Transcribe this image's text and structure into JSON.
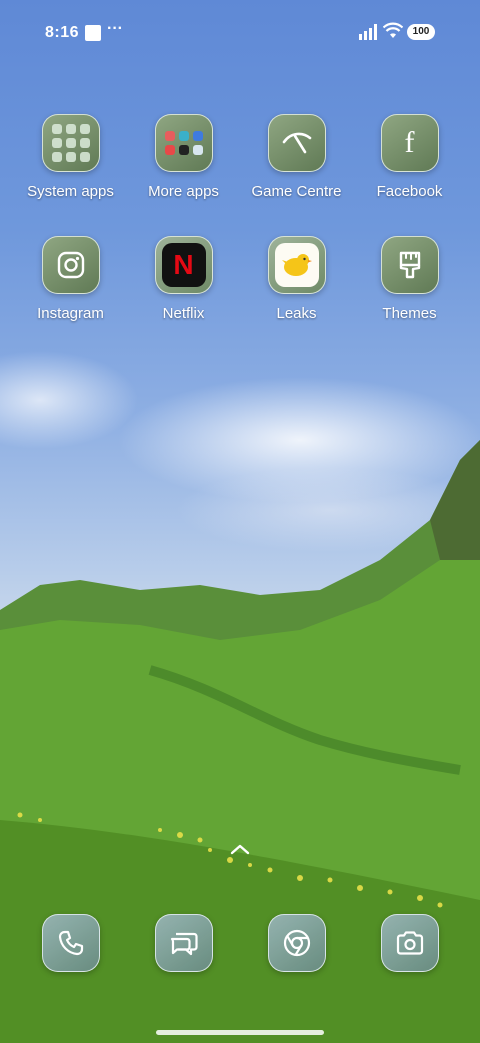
{
  "status_bar": {
    "time": "8:16",
    "extra_indicator": "···",
    "battery_level": "100"
  },
  "home_apps": [
    {
      "label": "System apps",
      "icon": "folder-icon"
    },
    {
      "label": "More apps",
      "icon": "folder-icon"
    },
    {
      "label": "Game Centre",
      "icon": "game-centre-icon"
    },
    {
      "label": "Facebook",
      "icon": "facebook-icon"
    },
    {
      "label": "Instagram",
      "icon": "instagram-icon"
    },
    {
      "label": "Netflix",
      "icon": "netflix-icon"
    },
    {
      "label": "Leaks",
      "icon": "leaks-bird-icon"
    },
    {
      "label": "Themes",
      "icon": "paintbrush-icon"
    }
  ],
  "netflix_letter": "N",
  "facebook_letter": "f",
  "dock": [
    {
      "name": "Phone",
      "icon": "phone-icon"
    },
    {
      "name": "Messages",
      "icon": "messages-icon"
    },
    {
      "name": "Browser",
      "icon": "chrome-icon"
    },
    {
      "name": "Camera",
      "icon": "camera-icon"
    }
  ],
  "colors": {
    "icon_tint": "#6d8762",
    "netflix_red": "#e50914",
    "leaks_yellow": "#f5c518"
  }
}
